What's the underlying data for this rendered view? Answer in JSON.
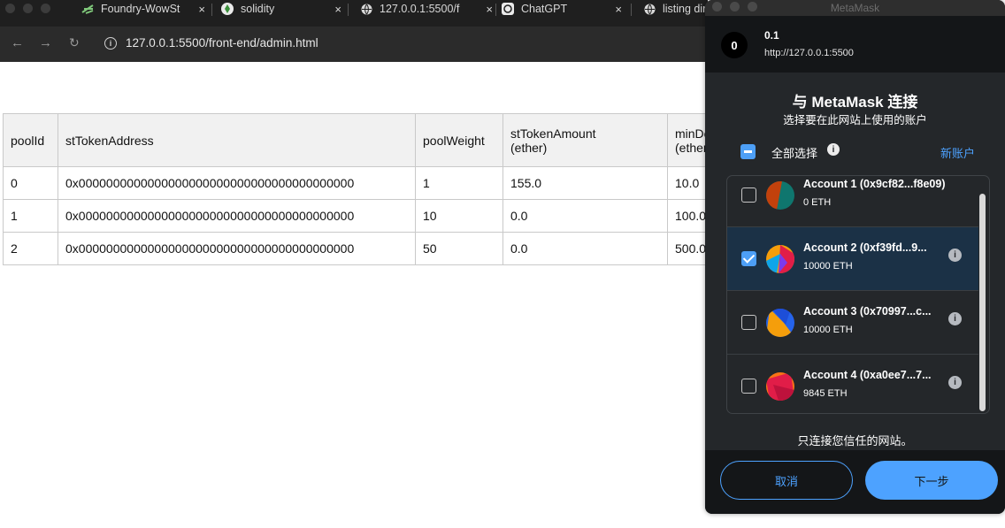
{
  "browser": {
    "tabs": [
      {
        "title": "Foundry-WowSt",
        "icon": "foundry-icon"
      },
      {
        "title": "solidity",
        "icon": "solidity-icon"
      },
      {
        "title": "127.0.0.1:5500/f",
        "icon": "globe-icon"
      },
      {
        "title": "ChatGPT",
        "icon": "chatgpt-icon"
      },
      {
        "title": "listing dir",
        "icon": "globe-icon"
      }
    ],
    "close_glyph": "×",
    "url": "127.0.0.1:5500/front-end/admin.html"
  },
  "table": {
    "headers": [
      [
        "poolId",
        ""
      ],
      [
        "stTokenAddress",
        ""
      ],
      [
        "poolWeight",
        ""
      ],
      [
        "stTokenAmount",
        "(ether)"
      ],
      [
        "minDe",
        "(ether"
      ]
    ],
    "rows": [
      [
        "0",
        "0x0000000000000000000000000000000000000000",
        "1",
        "155.0",
        "10.0"
      ],
      [
        "1",
        "0x0000000000000000000000000000000000000000",
        "10",
        "0.0",
        "100.0"
      ],
      [
        "2",
        "0x0000000000000000000000000000000000000000",
        "50",
        "0.0",
        "500.0"
      ]
    ]
  },
  "metamask": {
    "window_title": "MetaMask",
    "site": {
      "avatar_letter": "0",
      "name": "0.1",
      "url": "http://127.0.0.1:5500"
    },
    "title": "与 MetaMask 连接",
    "subtitle": "选择要在此网站上使用的账户",
    "select_all_label": "全部选择",
    "new_account_label": "新账户",
    "accounts": [
      {
        "name": "Account 1 (0x9cf82...f8e09)",
        "balance": "0 ETH",
        "checked": false,
        "colors": [
          "#c2410c",
          "#0f766e"
        ]
      },
      {
        "name": "Account 2 (0xf39fd...9...",
        "balance": "10000 ETH",
        "checked": true,
        "colors": [
          "#f59e0b",
          "#e11d48",
          "#0ea5e9"
        ]
      },
      {
        "name": "Account 3 (0x70997...c...",
        "balance": "10000 ETH",
        "checked": false,
        "colors": [
          "#2563eb",
          "#f59e0b"
        ]
      },
      {
        "name": "Account 4 (0xa0ee7...7...",
        "balance": "9845 ETH",
        "checked": false,
        "colors": [
          "#f97316",
          "#e11d48"
        ]
      }
    ],
    "trust_text": "只连接您信任的网站。",
    "cancel_label": "取消",
    "next_label": "下一步",
    "accent": "#4da2ff"
  }
}
